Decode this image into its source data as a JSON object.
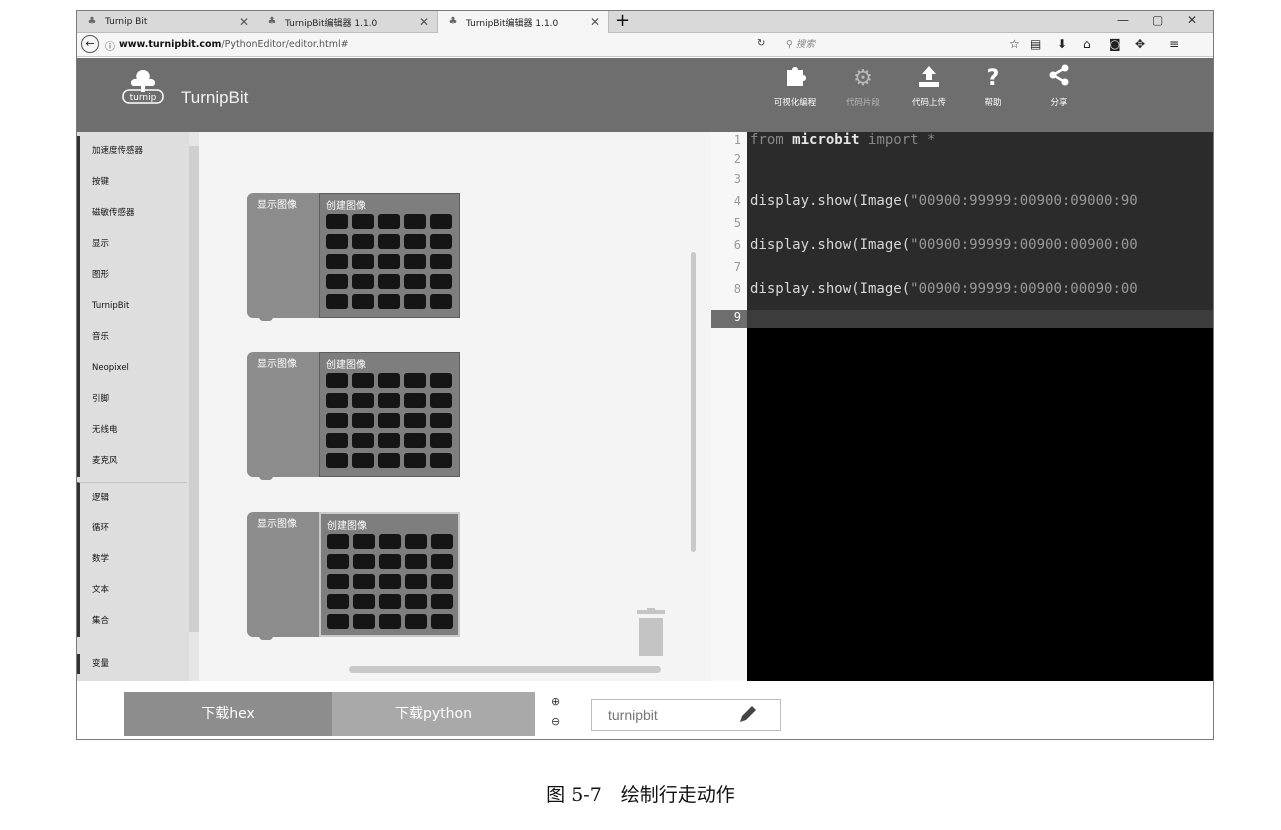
{
  "browser": {
    "tabs": [
      {
        "title": "Turnip Bit",
        "active": false
      },
      {
        "title": "TurnipBit编辑器 1.1.0",
        "active": false
      },
      {
        "title": "TurnipBit编辑器 1.1.0",
        "active": true
      }
    ],
    "url_domain": "www.turnipbit.com",
    "url_path": "/PythonEditor/editor.html#",
    "search_placeholder": "搜索"
  },
  "app": {
    "brand": "TurnipBit",
    "logo_text": "turnip",
    "toolbar": [
      {
        "label": "可视化编程",
        "icon": "puzzle-icon",
        "dim": false
      },
      {
        "label": "代码片段",
        "icon": "gears-icon",
        "dim": true
      },
      {
        "label": "代码上传",
        "icon": "upload-icon",
        "dim": false
      },
      {
        "label": "帮助",
        "icon": "help-icon",
        "dim": false
      },
      {
        "label": "分享",
        "icon": "share-icon",
        "dim": false
      }
    ]
  },
  "sidebar": {
    "categories": [
      "加速度传感器",
      "按键",
      "磁敏传感器",
      "显示",
      "图形",
      "TurnipBit",
      "音乐",
      "Neopixel",
      "引脚",
      "无线电",
      "麦克风",
      "逻辑",
      "循环",
      "数学",
      "文本",
      "集合",
      "变量"
    ]
  },
  "workspace": {
    "blocks": [
      {
        "label": "显示图像",
        "inner_label": "创建图像"
      },
      {
        "label": "显示图像",
        "inner_label": "创建图像"
      },
      {
        "label": "显示图像",
        "inner_label": "创建图像"
      }
    ]
  },
  "editor": {
    "line_numbers": [
      "1",
      "2",
      "3",
      "4",
      "5",
      "6",
      "7",
      "8",
      "9"
    ],
    "lines": {
      "l1_from": "from ",
      "l1_module": "microbit",
      "l1_rest": " import *",
      "l4_call": "display.show(Image(",
      "l4_str": "\"00900:99999:00900:09000:90",
      "l6_call": "display.show(Image(",
      "l6_str": "\"00900:99999:00900:00900:00",
      "l8_call": "display.show(Image(",
      "l8_str": "\"00900:99999:00900:00090:00"
    },
    "active_line": 9
  },
  "bottom": {
    "download_hex": "下载hex",
    "download_python": "下载python",
    "project_name": "turnipbit"
  },
  "caption": "图 5-7　绘制行走动作"
}
